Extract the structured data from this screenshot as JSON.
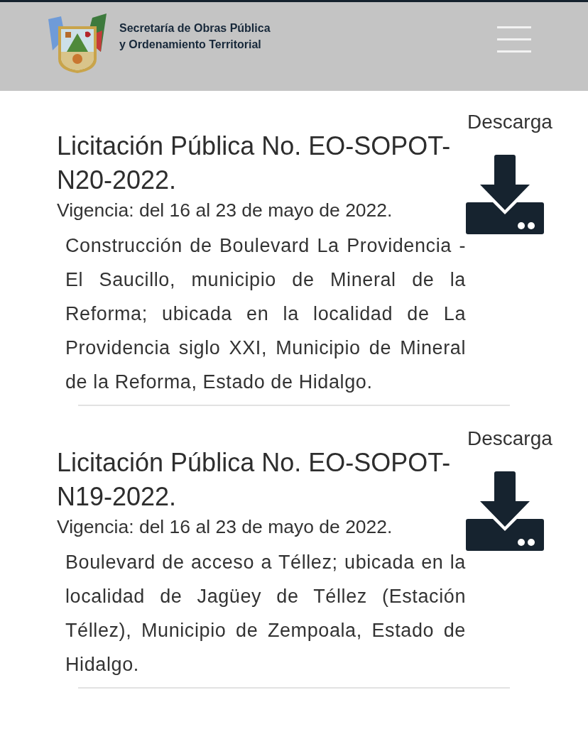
{
  "header": {
    "title_lines": [
      "Secretaría de Obras Pública",
      "y Ordenamiento Territorial"
    ]
  },
  "items": [
    {
      "title": "Licitación Pública No. EO-SOPOT-N20-2022.",
      "validity": "Vigencia: del 16 al 23 de mayo de 2022.",
      "description": "Construcción de Boulevard La Providencia - El Saucillo, municipio de Mineral de la Reforma; ubicada en la localidad de La Providencia siglo XXI, Municipio de Mineral de la Reforma, Estado de Hidalgo.",
      "download_label": "Descarga"
    },
    {
      "title": "Licitación Pública No. EO-SOPOT-N19-2022.",
      "validity": "Vigencia: del 16 al 23 de mayo de 2022.",
      "description": "Boulevard de acceso a Téllez; ubicada en la localidad de Jagüey de Téllez (Estación Téllez), Municipio de Zempoala, Estado de Hidalgo.",
      "download_label": "Descarga"
    }
  ]
}
